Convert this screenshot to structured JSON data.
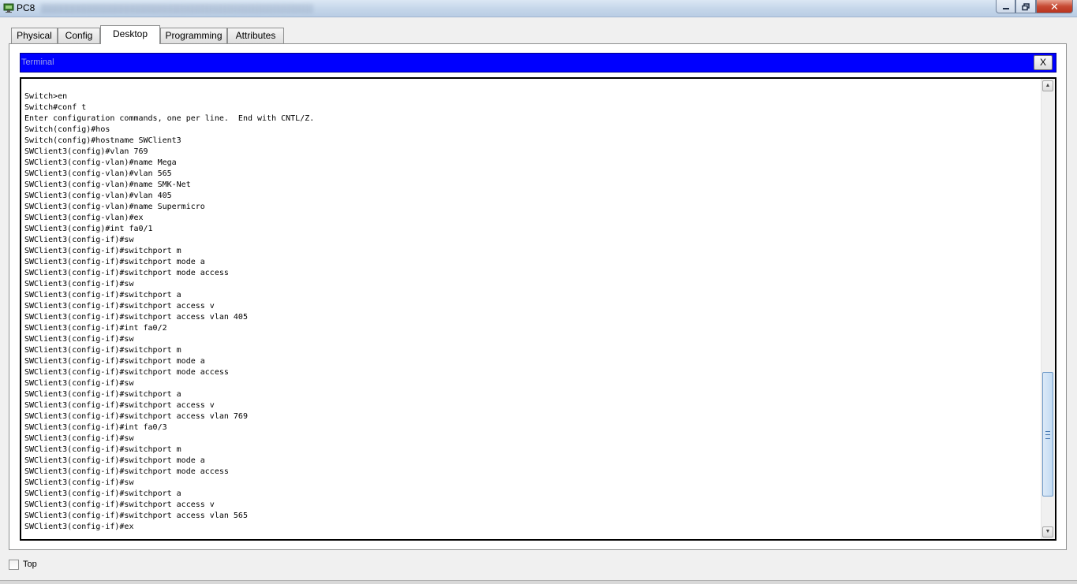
{
  "window": {
    "title": "PC8",
    "controls": {
      "minimize_icon": "minimize-icon",
      "maximize_icon": "maximize-icon",
      "close_label": "✕"
    }
  },
  "tabs": [
    {
      "label": "Physical",
      "active": false
    },
    {
      "label": "Config",
      "active": false
    },
    {
      "label": "Desktop",
      "active": true
    },
    {
      "label": "Programming",
      "active": false
    },
    {
      "label": "Attributes",
      "active": false
    }
  ],
  "terminal": {
    "title": "Terminal",
    "close_label": "X",
    "header_color": "#0000ff",
    "lines": [
      "Switch>en",
      "Switch#conf t",
      "Enter configuration commands, one per line.  End with CNTL/Z.",
      "Switch(config)#hos",
      "Switch(config)#hostname SWClient3",
      "SWClient3(config)#vlan 769",
      "SWClient3(config-vlan)#name Mega",
      "SWClient3(config-vlan)#vlan 565",
      "SWClient3(config-vlan)#name SMK-Net",
      "SWClient3(config-vlan)#vlan 405",
      "SWClient3(config-vlan)#name Supermicro",
      "SWClient3(config-vlan)#ex",
      "SWClient3(config)#int fa0/1",
      "SWClient3(config-if)#sw",
      "SWClient3(config-if)#switchport m",
      "SWClient3(config-if)#switchport mode a",
      "SWClient3(config-if)#switchport mode access",
      "SWClient3(config-if)#sw",
      "SWClient3(config-if)#switchport a",
      "SWClient3(config-if)#switchport access v",
      "SWClient3(config-if)#switchport access vlan 405",
      "SWClient3(config-if)#int fa0/2",
      "SWClient3(config-if)#sw",
      "SWClient3(config-if)#switchport m",
      "SWClient3(config-if)#switchport mode a",
      "SWClient3(config-if)#switchport mode access",
      "SWClient3(config-if)#sw",
      "SWClient3(config-if)#switchport a",
      "SWClient3(config-if)#switchport access v",
      "SWClient3(config-if)#switchport access vlan 769",
      "SWClient3(config-if)#int fa0/3",
      "SWClient3(config-if)#sw",
      "SWClient3(config-if)#switchport m",
      "SWClient3(config-if)#switchport mode a",
      "SWClient3(config-if)#switchport mode access",
      "SWClient3(config-if)#sw",
      "SWClient3(config-if)#switchport a",
      "SWClient3(config-if)#switchport access v",
      "SWClient3(config-if)#switchport access vlan 565",
      "SWClient3(config-if)#ex"
    ],
    "scroll_position": 0.95
  },
  "footer": {
    "top_checkbox_label": "Top",
    "top_checked": false
  }
}
